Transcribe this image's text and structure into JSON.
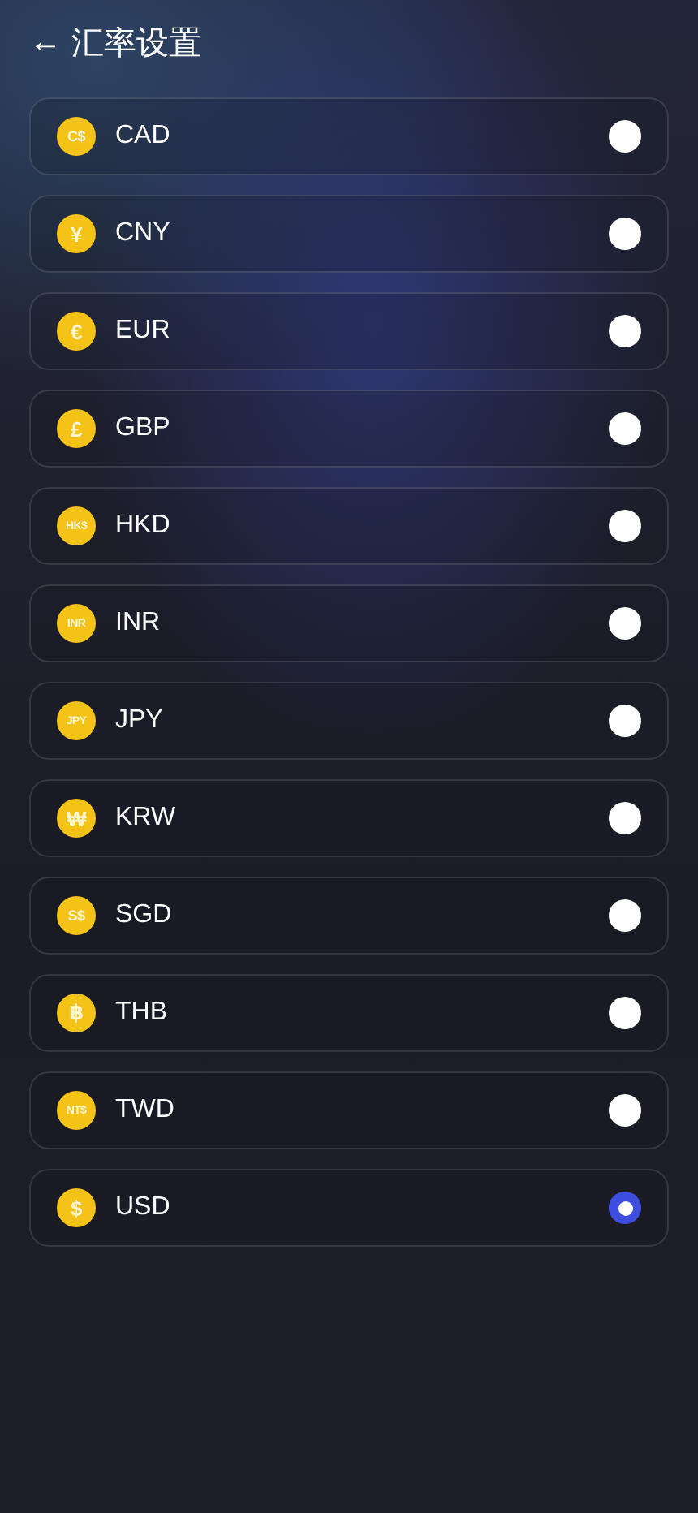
{
  "header": {
    "back_icon": "←",
    "title": "汇率设置"
  },
  "currencies": [
    {
      "symbol": "C$",
      "code": "CAD",
      "selected": false
    },
    {
      "symbol": "¥",
      "code": "CNY",
      "selected": false
    },
    {
      "symbol": "€",
      "code": "EUR",
      "selected": false
    },
    {
      "symbol": "£",
      "code": "GBP",
      "selected": false
    },
    {
      "symbol": "HK$",
      "code": "HKD",
      "selected": false
    },
    {
      "symbol": "INR",
      "code": "INR",
      "selected": false
    },
    {
      "symbol": "JPY",
      "code": "JPY",
      "selected": false
    },
    {
      "symbol": "₩",
      "code": "KRW",
      "selected": false
    },
    {
      "symbol": "S$",
      "code": "SGD",
      "selected": false
    },
    {
      "symbol": "฿",
      "code": "THB",
      "selected": false
    },
    {
      "symbol": "NT$",
      "code": "TWD",
      "selected": false
    },
    {
      "symbol": "$",
      "code": "USD",
      "selected": true
    }
  ]
}
